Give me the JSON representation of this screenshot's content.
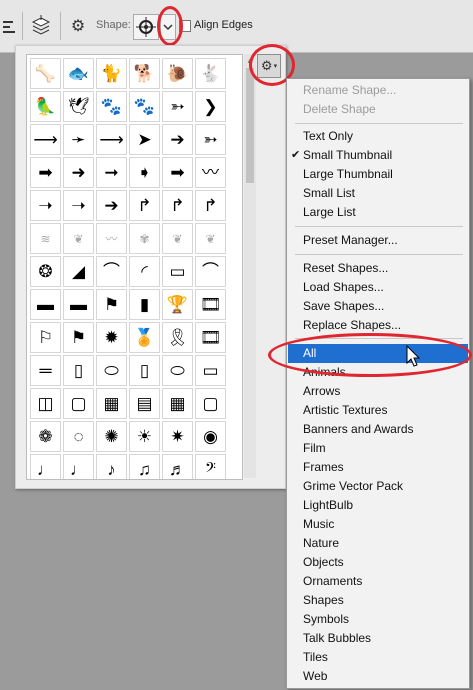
{
  "toolbar": {
    "shape_label": "Shape:",
    "align_edges_label": "Align Edges",
    "accent_color": "#e0262f"
  },
  "shape_picker": {
    "gear_icon": "gear-icon",
    "shapes": [
      "🦴",
      "🐟",
      "🐈",
      "🐕",
      "🐌",
      "🐇",
      "🦜",
      "🕊",
      "🐾",
      "🐾",
      "➳",
      "❯",
      "⟶",
      "➛",
      "⟶",
      "➤",
      "➔",
      "➳",
      "➡",
      "➜",
      "➞",
      "➧",
      "➡",
      "〰",
      "➝",
      "➝",
      "➔",
      "↱",
      "↱",
      "↱",
      "≋",
      "❦",
      "〰",
      "✾",
      "❦",
      "❦",
      "❂",
      "◢",
      "⌒",
      "◜",
      "▭",
      "⌒",
      "▬",
      "▬",
      "⚑",
      "▮",
      "🏆",
      "🎞",
      "⚐",
      "⚑",
      "✹",
      "🏅",
      "🎗",
      "🎞",
      "═",
      "▯",
      "⬭",
      "▯",
      "⬭",
      "▭",
      "◫",
      "▢",
      "▦",
      "▤",
      "▦",
      "▢",
      "❁",
      "◌",
      "✺",
      "☀",
      "✷",
      "◉",
      "♩",
      "♩",
      "♪",
      "♫",
      "♬",
      "𝄢",
      "♩",
      "♩",
      "♩",
      "♩",
      "♩",
      "♩"
    ]
  },
  "menu": {
    "rename": "Rename Shape...",
    "delete": "Delete Shape",
    "view_items": [
      "Text Only",
      "Small Thumbnail",
      "Large Thumbnail",
      "Small List",
      "Large List"
    ],
    "checked_index": 1,
    "preset_manager": "Preset Manager...",
    "manage_items": [
      "Reset Shapes...",
      "Load Shapes...",
      "Save Shapes...",
      "Replace Shapes..."
    ],
    "libraries": [
      "All",
      "Animals",
      "Arrows",
      "Artistic Textures",
      "Banners and Awards",
      "Film",
      "Frames",
      "Grime Vector Pack",
      "LightBulb",
      "Music",
      "Nature",
      "Objects",
      "Ornaments",
      "Shapes",
      "Symbols",
      "Talk Bubbles",
      "Tiles",
      "Web"
    ],
    "selected_library": "All",
    "selection_color": "#1e6fd0"
  }
}
